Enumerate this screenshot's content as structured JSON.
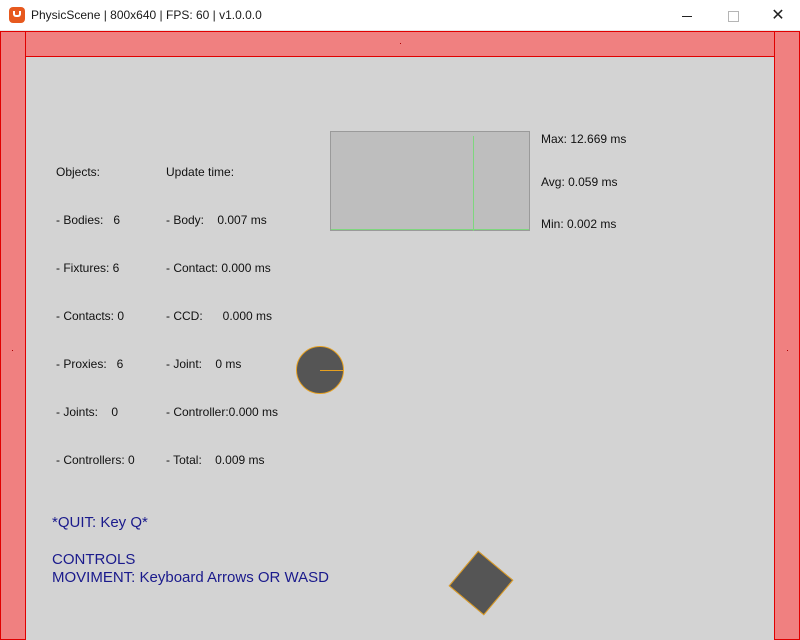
{
  "window": {
    "title": "PhysicScene | 800x640 | FPS: 60 | v1.0.0.0",
    "minimize_icon": "minimize-icon",
    "maximize_icon": "maximize-icon",
    "close_icon": "close-icon",
    "close_glyph": "✕"
  },
  "debug": {
    "objects": [
      "Objects:",
      "- Bodies:   6",
      "- Fixtures: 6",
      "- Contacts: 0",
      "- Proxies:   6",
      "- Joints:    0",
      "- Controllers: 0"
    ],
    "update_time": [
      "Update time:",
      "- Body:    0.007 ms",
      "- Contact: 0.000 ms",
      "- CCD:      0.000 ms",
      "- Joint:    0 ms",
      "- Controller:0.000 ms",
      "- Total:    0.009 ms"
    ]
  },
  "stats": {
    "max": "Max: 12.669 ms",
    "avg": "Avg: 0.059 ms",
    "min": "Min: 0.002 ms"
  },
  "help": {
    "quit": "*QUIT: Key Q*",
    "controls": "CONTROLS",
    "movement": "MOVIMENT: Keyboard Arrows OR WASD"
  },
  "colors": {
    "wall_fill": "#f08080",
    "wall_border": "#e00000",
    "body_fill": "#555555",
    "body_outline": "#e6a020",
    "graph_line": "#7ed67e",
    "help_text": "#1a1a8c"
  }
}
